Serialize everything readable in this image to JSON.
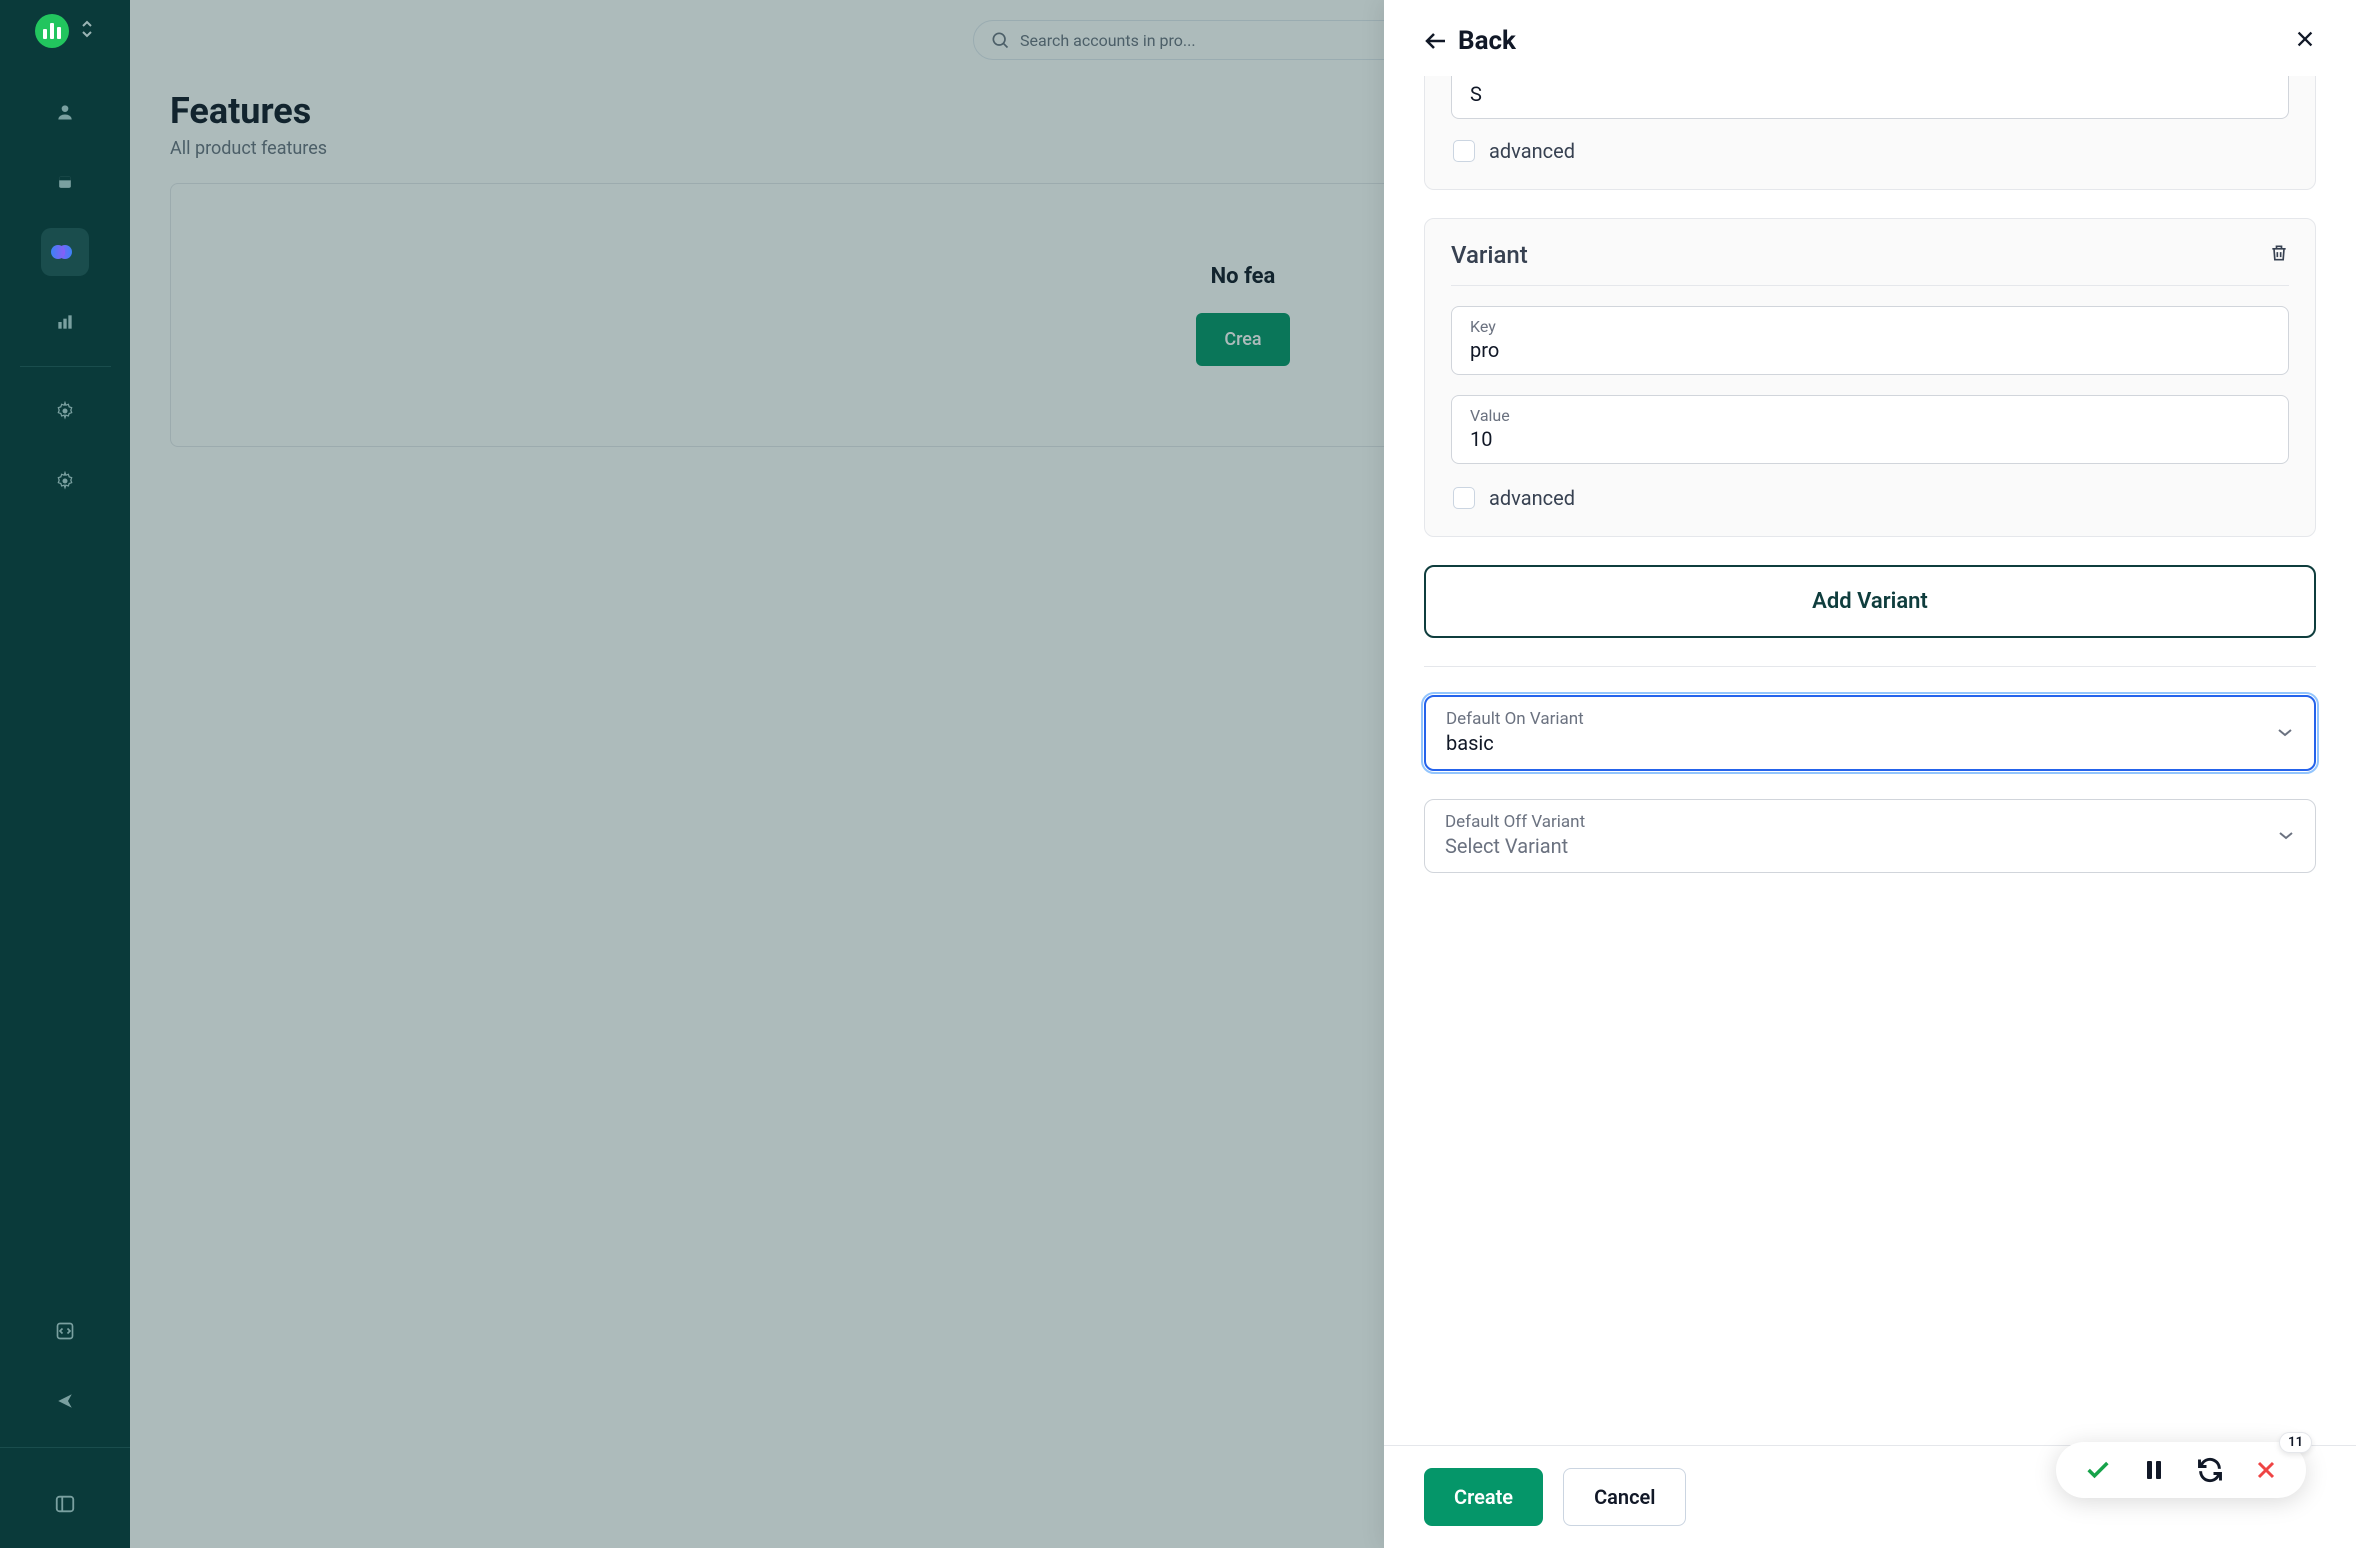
{
  "search": {
    "placeholder": "Search accounts in pro..."
  },
  "page": {
    "title": "Features",
    "subtitle": "All product features",
    "empty_title": "No fea",
    "create_button": "Crea"
  },
  "drawer": {
    "back_label": "Back",
    "truncated_value": "S",
    "truncated_advanced": "advanced",
    "variant_card": {
      "title": "Variant",
      "key_label": "Key",
      "key_value": "pro",
      "value_label": "Value",
      "value_value": "10",
      "advanced_label": "advanced"
    },
    "add_variant": "Add Variant",
    "default_on": {
      "label": "Default On Variant",
      "value": "basic"
    },
    "default_off": {
      "label": "Default Off Variant",
      "placeholder": "Select Variant"
    },
    "footer": {
      "create": "Create",
      "cancel": "Cancel"
    }
  },
  "float": {
    "badge": "11"
  }
}
